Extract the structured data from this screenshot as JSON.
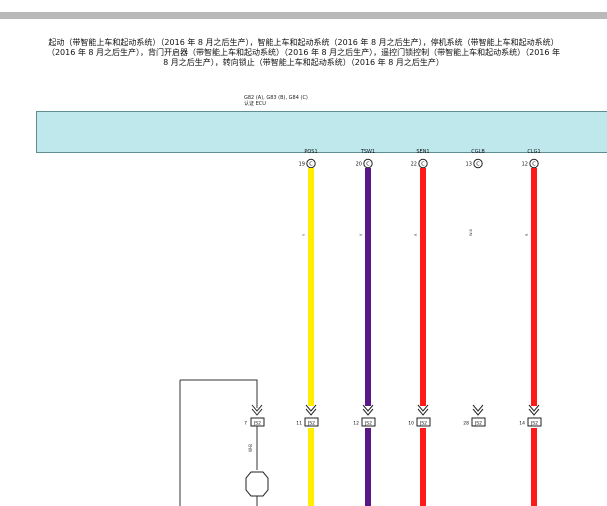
{
  "title": {
    "line1": "起动（带智能上车和起动系统）（2016 年 8 月之后生产），智能上车和起动系统（2016 年 8 月之后生产），停机系统（带智能上车和起动系统）",
    "line2": "（2016 年 8 月之后生产），背门开启器（带智能上车和起动系统）（2016 年 8 月之后生产），遥控门锁控制（带智能上车和起动系统）（2016 年",
    "line3": "8 月之后生产），转向锁止（带智能上车和起动系统）（2016 年 8 月之后生产）"
  },
  "ecu": {
    "connectors": "G82 (A), G83 (B), G84 (C)",
    "name": "认证 ECU"
  },
  "pins": [
    {
      "label": "POS1",
      "pin": "19",
      "conn": "C",
      "wire_color": "#ffee00",
      "wire_code": "Y",
      "lower_pin": "11",
      "lower_conn": "JS2"
    },
    {
      "label": "TSW1",
      "pin": "20",
      "conn": "C",
      "wire_color": "#5a1887",
      "wire_code": "V",
      "lower_pin": "12",
      "lower_conn": "JS2"
    },
    {
      "label": "SEN1",
      "pin": "22",
      "conn": "C",
      "wire_color": "#ff1a1a",
      "wire_code": "R",
      "lower_pin": "10",
      "lower_conn": "JS2"
    },
    {
      "label": "CGLB",
      "pin": "13",
      "conn": "C",
      "wire_color": null,
      "wire_code": "W-B",
      "lower_pin": "28",
      "lower_conn": "JS2"
    },
    {
      "label": "CLG1",
      "pin": "12",
      "conn": "C",
      "wire_color": "#ff1a1a",
      "wire_code": "R",
      "lower_pin": "14",
      "lower_conn": "JS2"
    }
  ],
  "left_branch": {
    "lower_pin": "7",
    "lower_conn": "JS2",
    "wire_code": "W-B"
  }
}
